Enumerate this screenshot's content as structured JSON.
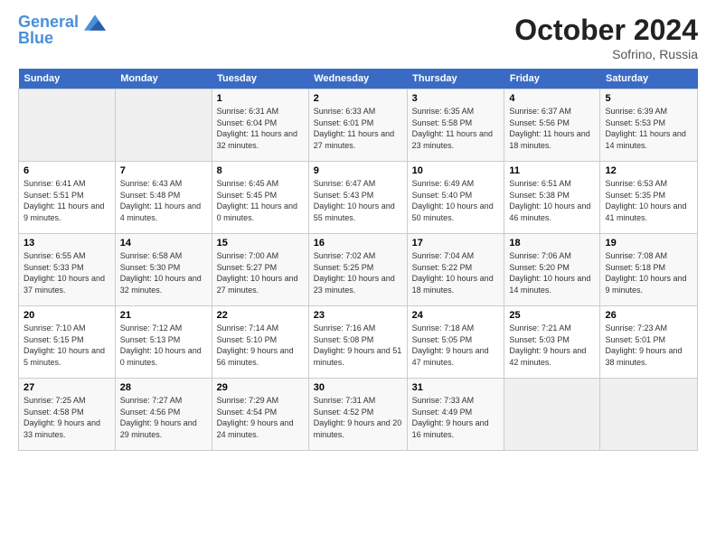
{
  "header": {
    "logo_line1": "General",
    "logo_line2": "Blue",
    "month": "October 2024",
    "location": "Sofrino, Russia"
  },
  "days_of_week": [
    "Sunday",
    "Monday",
    "Tuesday",
    "Wednesday",
    "Thursday",
    "Friday",
    "Saturday"
  ],
  "weeks": [
    [
      {
        "day": "",
        "info": ""
      },
      {
        "day": "",
        "info": ""
      },
      {
        "day": "1",
        "info": "Sunrise: 6:31 AM\nSunset: 6:04 PM\nDaylight: 11 hours and 32 minutes."
      },
      {
        "day": "2",
        "info": "Sunrise: 6:33 AM\nSunset: 6:01 PM\nDaylight: 11 hours and 27 minutes."
      },
      {
        "day": "3",
        "info": "Sunrise: 6:35 AM\nSunset: 5:58 PM\nDaylight: 11 hours and 23 minutes."
      },
      {
        "day": "4",
        "info": "Sunrise: 6:37 AM\nSunset: 5:56 PM\nDaylight: 11 hours and 18 minutes."
      },
      {
        "day": "5",
        "info": "Sunrise: 6:39 AM\nSunset: 5:53 PM\nDaylight: 11 hours and 14 minutes."
      }
    ],
    [
      {
        "day": "6",
        "info": "Sunrise: 6:41 AM\nSunset: 5:51 PM\nDaylight: 11 hours and 9 minutes."
      },
      {
        "day": "7",
        "info": "Sunrise: 6:43 AM\nSunset: 5:48 PM\nDaylight: 11 hours and 4 minutes."
      },
      {
        "day": "8",
        "info": "Sunrise: 6:45 AM\nSunset: 5:45 PM\nDaylight: 11 hours and 0 minutes."
      },
      {
        "day": "9",
        "info": "Sunrise: 6:47 AM\nSunset: 5:43 PM\nDaylight: 10 hours and 55 minutes."
      },
      {
        "day": "10",
        "info": "Sunrise: 6:49 AM\nSunset: 5:40 PM\nDaylight: 10 hours and 50 minutes."
      },
      {
        "day": "11",
        "info": "Sunrise: 6:51 AM\nSunset: 5:38 PM\nDaylight: 10 hours and 46 minutes."
      },
      {
        "day": "12",
        "info": "Sunrise: 6:53 AM\nSunset: 5:35 PM\nDaylight: 10 hours and 41 minutes."
      }
    ],
    [
      {
        "day": "13",
        "info": "Sunrise: 6:55 AM\nSunset: 5:33 PM\nDaylight: 10 hours and 37 minutes."
      },
      {
        "day": "14",
        "info": "Sunrise: 6:58 AM\nSunset: 5:30 PM\nDaylight: 10 hours and 32 minutes."
      },
      {
        "day": "15",
        "info": "Sunrise: 7:00 AM\nSunset: 5:27 PM\nDaylight: 10 hours and 27 minutes."
      },
      {
        "day": "16",
        "info": "Sunrise: 7:02 AM\nSunset: 5:25 PM\nDaylight: 10 hours and 23 minutes."
      },
      {
        "day": "17",
        "info": "Sunrise: 7:04 AM\nSunset: 5:22 PM\nDaylight: 10 hours and 18 minutes."
      },
      {
        "day": "18",
        "info": "Sunrise: 7:06 AM\nSunset: 5:20 PM\nDaylight: 10 hours and 14 minutes."
      },
      {
        "day": "19",
        "info": "Sunrise: 7:08 AM\nSunset: 5:18 PM\nDaylight: 10 hours and 9 minutes."
      }
    ],
    [
      {
        "day": "20",
        "info": "Sunrise: 7:10 AM\nSunset: 5:15 PM\nDaylight: 10 hours and 5 minutes."
      },
      {
        "day": "21",
        "info": "Sunrise: 7:12 AM\nSunset: 5:13 PM\nDaylight: 10 hours and 0 minutes."
      },
      {
        "day": "22",
        "info": "Sunrise: 7:14 AM\nSunset: 5:10 PM\nDaylight: 9 hours and 56 minutes."
      },
      {
        "day": "23",
        "info": "Sunrise: 7:16 AM\nSunset: 5:08 PM\nDaylight: 9 hours and 51 minutes."
      },
      {
        "day": "24",
        "info": "Sunrise: 7:18 AM\nSunset: 5:05 PM\nDaylight: 9 hours and 47 minutes."
      },
      {
        "day": "25",
        "info": "Sunrise: 7:21 AM\nSunset: 5:03 PM\nDaylight: 9 hours and 42 minutes."
      },
      {
        "day": "26",
        "info": "Sunrise: 7:23 AM\nSunset: 5:01 PM\nDaylight: 9 hours and 38 minutes."
      }
    ],
    [
      {
        "day": "27",
        "info": "Sunrise: 7:25 AM\nSunset: 4:58 PM\nDaylight: 9 hours and 33 minutes."
      },
      {
        "day": "28",
        "info": "Sunrise: 7:27 AM\nSunset: 4:56 PM\nDaylight: 9 hours and 29 minutes."
      },
      {
        "day": "29",
        "info": "Sunrise: 7:29 AM\nSunset: 4:54 PM\nDaylight: 9 hours and 24 minutes."
      },
      {
        "day": "30",
        "info": "Sunrise: 7:31 AM\nSunset: 4:52 PM\nDaylight: 9 hours and 20 minutes."
      },
      {
        "day": "31",
        "info": "Sunrise: 7:33 AM\nSunset: 4:49 PM\nDaylight: 9 hours and 16 minutes."
      },
      {
        "day": "",
        "info": ""
      },
      {
        "day": "",
        "info": ""
      }
    ]
  ]
}
